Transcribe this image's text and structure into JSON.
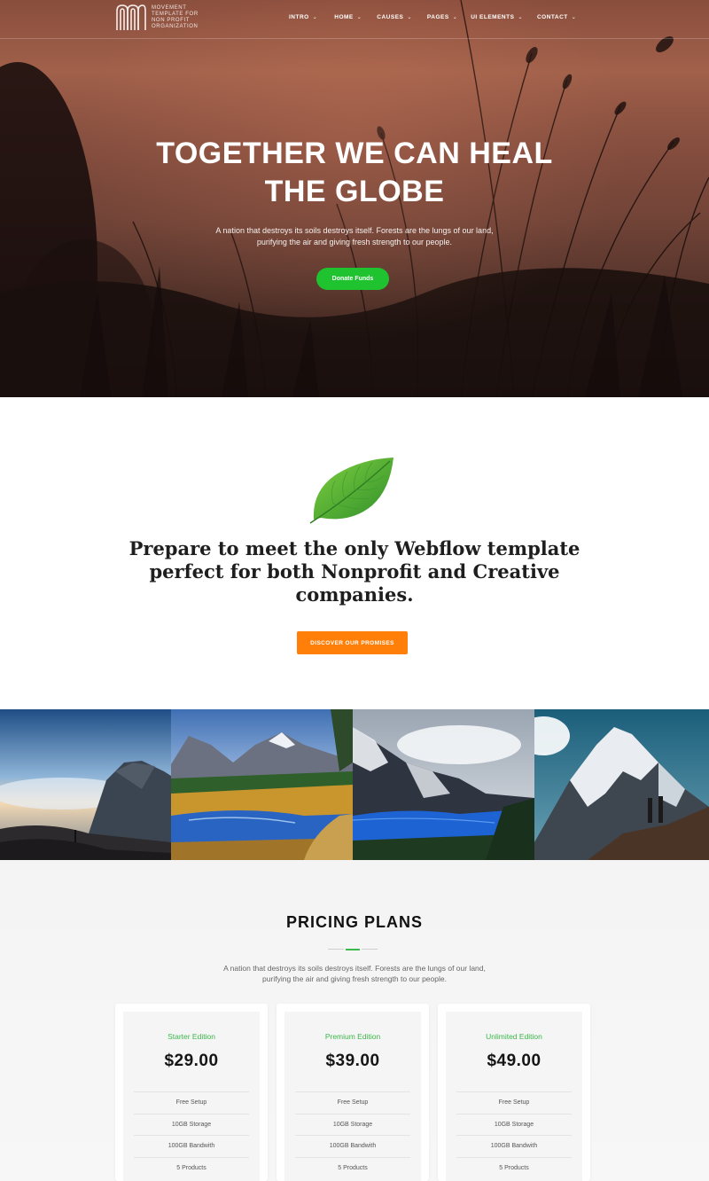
{
  "brand": {
    "logo_text": "MOVEMENT TEMPLATE FOR NON PROFIT ORGANIZATION"
  },
  "nav": {
    "items": [
      {
        "label": "INTRO"
      },
      {
        "label": "HOME"
      },
      {
        "label": "CAUSES"
      },
      {
        "label": "PAGES"
      },
      {
        "label": "UI ELEMENTS"
      },
      {
        "label": "CONTACT"
      }
    ],
    "chevron_icon": "chevron-down-icon"
  },
  "hero": {
    "title_line1": "TOGETHER WE CAN HEAL",
    "title_line2": "THE GLOBE",
    "subtitle": "A nation that destroys its soils destroys itself. Forests are the lungs of our land, purifying the air and giving fresh strength to our people.",
    "cta_label": "Donate Funds",
    "cta_color": "#1fc22f"
  },
  "intro": {
    "icon": "leaf-icon",
    "line1": "Prepare to meet the only Webflow template",
    "line2": "perfect  for both Nonprofit and Creative",
    "line3": "companies.",
    "cta_label": "DISCOVER OUR PROMISES",
    "cta_color": "#ff7f09"
  },
  "gallery": {
    "images": [
      {
        "name": "misty-mountain-hiker"
      },
      {
        "name": "autumn-lake-mountains"
      },
      {
        "name": "glacier-blue-lake"
      },
      {
        "name": "snowy-peak-hikers"
      }
    ]
  },
  "pricing": {
    "title": "PRICING PLANS",
    "subtitle": "A nation that destroys its soils destroys itself. Forests are the lungs of our land, purifying the air and giving fresh strength to our people.",
    "accent_color": "#3bb84a",
    "plans": [
      {
        "name": "Starter Edition",
        "price": "$29.00",
        "features": [
          "Free Setup",
          "10GB Storage",
          "100GB Bandwith",
          "5 Products"
        ]
      },
      {
        "name": "Premium Edition",
        "price": "$39.00",
        "features": [
          "Free Setup",
          "10GB Storage",
          "100GB Bandwith",
          "5 Products"
        ]
      },
      {
        "name": "Unlimited Edition",
        "price": "$49.00",
        "features": [
          "Free Setup",
          "10GB Storage",
          "100GB Bandwith",
          "5 Products"
        ]
      }
    ]
  }
}
